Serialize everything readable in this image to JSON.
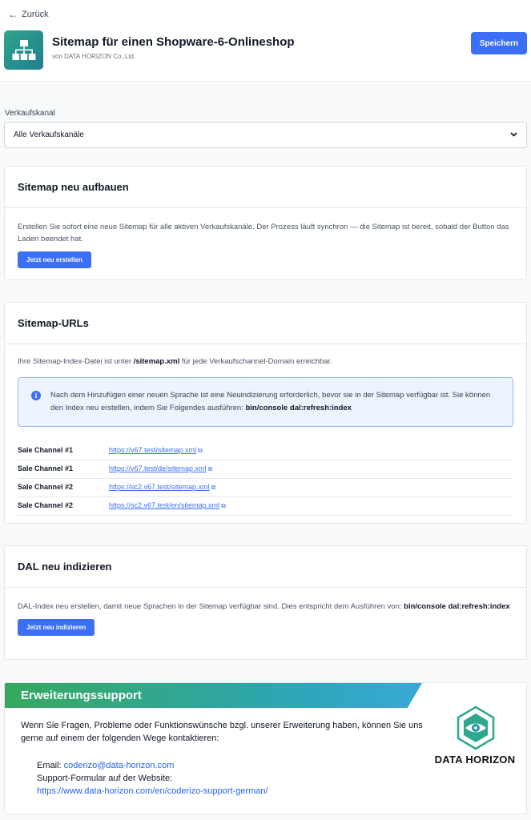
{
  "header": {
    "back_label": "Zurück",
    "title": "Sitemap für einen Shopware-6-Onlineshop",
    "subtitle": "von DATA HORIZON Co.,Ltd.",
    "save_label": "Speichern"
  },
  "sales_channel": {
    "label": "Verkaufskanal",
    "selected": "Alle Verkaufskanäle"
  },
  "rebuild": {
    "title": "Sitemap neu aufbauen",
    "description": "Erstellen Sie sofort eine neue Sitemap für alle aktiven Verkaufskanäle. Der Prozess läuft synchron — die Sitemap ist bereit, sobald der Button das Laden beendet hat.",
    "button": "Jetzt neu erstellen"
  },
  "urls": {
    "title": "Sitemap-URLs",
    "intro_prefix": "Ihre Sitemap-Index-Datei ist unter ",
    "intro_path": "/sitemap.xml",
    "intro_suffix": " für jede Verkaufschannel-Domain erreichbar.",
    "info_text": "Nach dem Hinzufügen einer neuen Sprache ist eine Neuindizierung erforderlich, bevor sie in der Sitemap verfügbar ist. Sie können den Index neu erstellen, indem Sie Folgendes ausführen: ",
    "info_command": "bin/console dal:refresh:index",
    "rows": [
      {
        "channel": "Sale Channel #1",
        "url": "https://v67.test/sitemap.xml"
      },
      {
        "channel": "Sale Channel #1",
        "url": "https://v67.test/de/sitemap.xml"
      },
      {
        "channel": "Sale Channel #2",
        "url": "https://sc2.v67.test/sitemap.xml"
      },
      {
        "channel": "Sale Channel #2",
        "url": "https://sc2.v67.test/en/sitemap.xml"
      }
    ]
  },
  "dal": {
    "title": "DAL neu indizieren",
    "description": "DAL-Index neu erstellen, damit neue Sprachen in der Sitemap verfügbar sind. Dies entspricht dem Ausführen von: ",
    "command": "bin/console dal:refresh:index",
    "button": "Jetzt neu indizieren"
  },
  "support": {
    "title": "Erweiterungssupport",
    "text": "Wenn Sie Fragen, Probleme oder Funktionswünsche bzgl. unserer Erweiterung haben, können Sie uns gerne auf einem der folgenden Wege kontaktieren:",
    "email_label": "Email: ",
    "email": "coderizo@data-horizon.com",
    "form_label": "Support-Formular auf der Website:",
    "form_url": "https://www.data-horizon.com/en/coderizo-support-german/",
    "logo_text": "DATA HORIZON"
  },
  "colors": {
    "primary": "#3b6ff5",
    "banner_start": "#36a85e",
    "banner_end": "#3aa8d8",
    "app_icon": "#2fa58a"
  },
  "icons": {
    "back": "arrow-left-icon",
    "app": "sitemap-tree-icon",
    "select": "chevron-down-icon",
    "info": "info-icon",
    "external": "external-link-icon",
    "logo": "data-horizon-logo-icon"
  }
}
